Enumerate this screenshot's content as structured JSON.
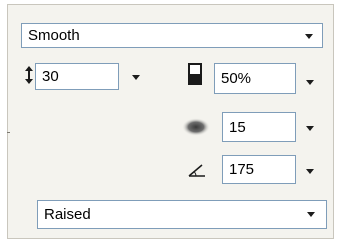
{
  "interpolation": {
    "value": "Smooth",
    "icon": "chevron-down-icon"
  },
  "spacing": {
    "value": "30",
    "icon": "vertical-resize-icon"
  },
  "opacity": {
    "value": "50%",
    "icon": "opacity-icon"
  },
  "blur": {
    "value": "15",
    "icon": "blur-icon"
  },
  "angle": {
    "value": "175",
    "icon": "angle-icon"
  },
  "style": {
    "value": "Raised"
  }
}
